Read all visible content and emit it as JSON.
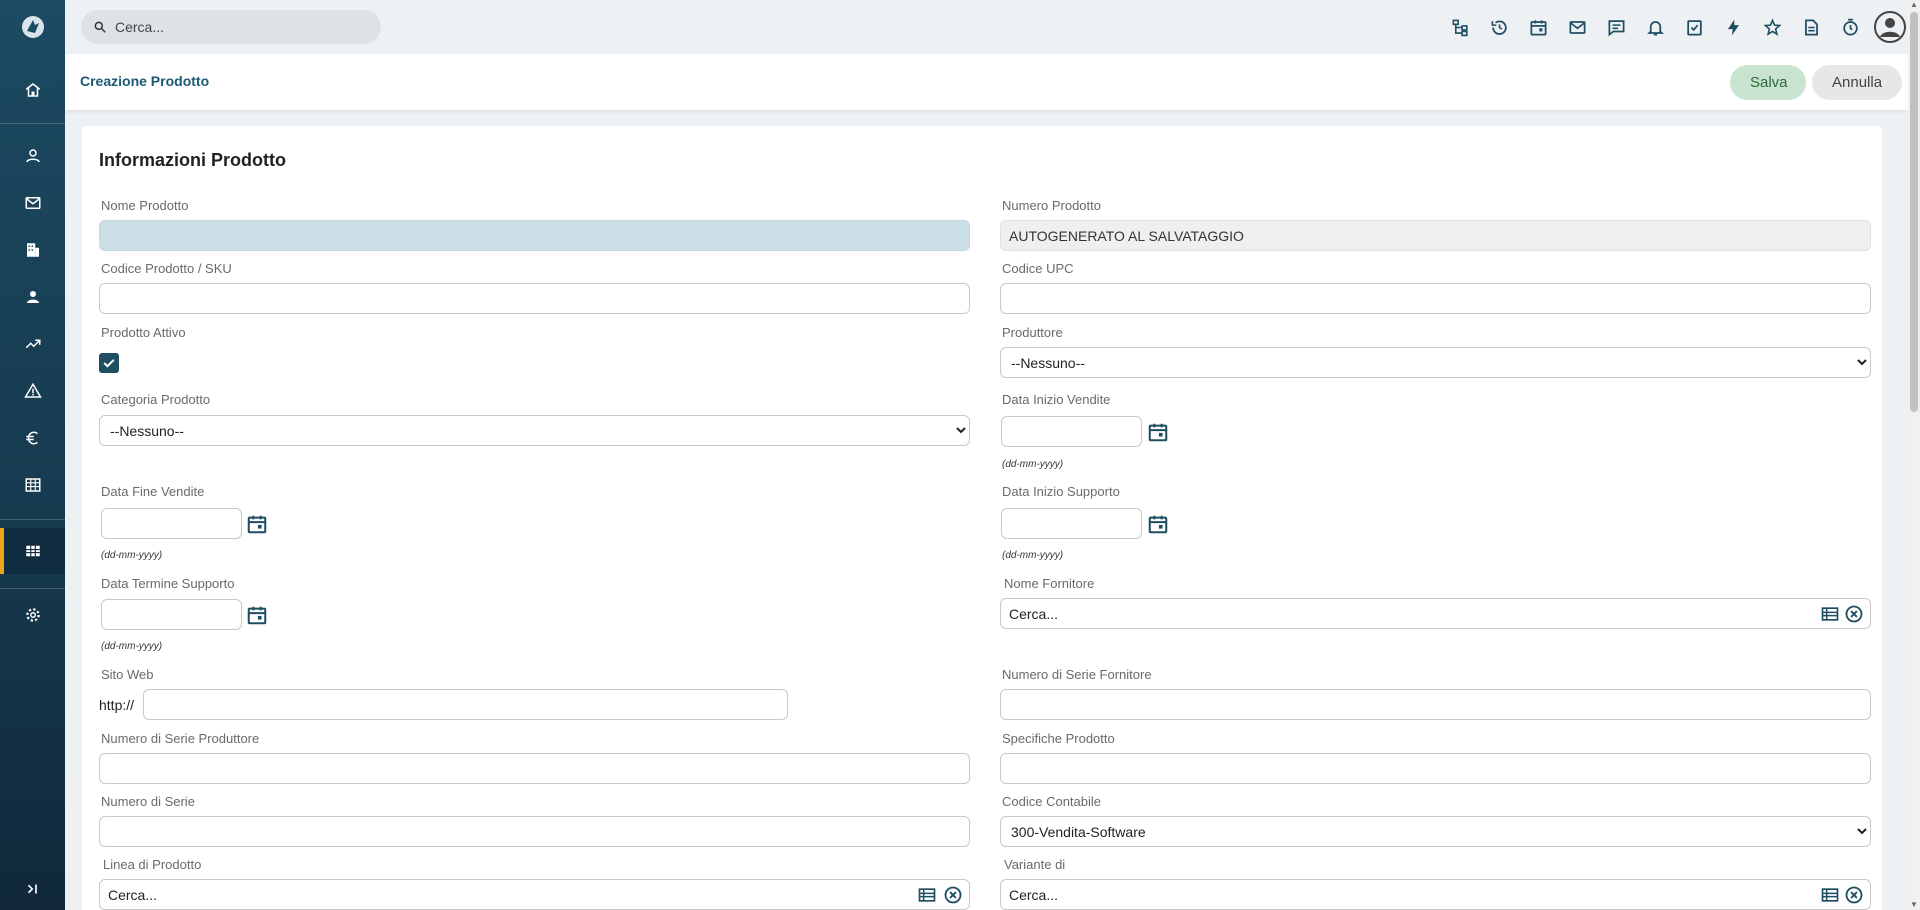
{
  "search": {
    "placeholder": "Cerca..."
  },
  "sidebar": {
    "items": [
      {
        "icon": "home-icon"
      },
      {
        "icon": "user-icon"
      },
      {
        "icon": "mail-icon"
      },
      {
        "icon": "building-icon"
      },
      {
        "icon": "contact-icon"
      },
      {
        "icon": "trend-icon"
      },
      {
        "icon": "warning-icon"
      },
      {
        "icon": "euro-icon"
      },
      {
        "icon": "table-icon"
      },
      {
        "icon": "grid-icon",
        "active": true
      },
      {
        "icon": "gear-icon"
      },
      {
        "icon": "collapse-icon"
      }
    ]
  },
  "topbar": {
    "icons": [
      "hierarchy-icon",
      "history-icon",
      "calendar-icon",
      "mail-icon",
      "chat-icon",
      "bell-icon",
      "task-icon",
      "bolt-icon",
      "star-icon",
      "document-icon",
      "timer-icon"
    ]
  },
  "header": {
    "title": "Creazione Prodotto",
    "save_label": "Salva",
    "cancel_label": "Annulla"
  },
  "form": {
    "section_title": "Informazioni Prodotto",
    "nome_prodotto": {
      "label": "Nome Prodotto",
      "value": ""
    },
    "numero_prodotto": {
      "label": "Numero Prodotto",
      "value": "AUTOGENERATO AL SALVATAGGIO"
    },
    "codice_prodotto": {
      "label": "Codice Prodotto / SKU",
      "value": ""
    },
    "codice_upc": {
      "label": "Codice UPC",
      "value": ""
    },
    "prodotto_attivo": {
      "label": "Prodotto Attivo",
      "checked": true
    },
    "produttore": {
      "label": "Produttore",
      "selected": "--Nessuno--"
    },
    "categoria": {
      "label": "Categoria Prodotto",
      "selected": "--Nessuno--"
    },
    "data_inizio_vendite": {
      "label": "Data Inizio Vendite",
      "hint": "(dd-mm-yyyy)"
    },
    "data_fine_vendite": {
      "label": "Data Fine Vendite",
      "hint": "(dd-mm-yyyy)"
    },
    "data_inizio_supporto": {
      "label": "Data Inizio Supporto",
      "hint": "(dd-mm-yyyy)"
    },
    "data_termine_supporto": {
      "label": "Data Termine Supporto",
      "hint": "(dd-mm-yyyy)"
    },
    "nome_fornitore": {
      "label": "Nome Fornitore",
      "placeholder": "Cerca..."
    },
    "sito_web": {
      "label": "Sito Web",
      "prefix": "http://"
    },
    "serie_fornitore": {
      "label": "Numero di Serie Fornitore"
    },
    "serie_produttore": {
      "label": "Numero di Serie Produttore"
    },
    "specifiche": {
      "label": "Specifiche Prodotto"
    },
    "numero_serie": {
      "label": "Numero di Serie"
    },
    "codice_contabile": {
      "label": "Codice Contabile",
      "selected": "300-Vendita-Software"
    },
    "linea_prodotto": {
      "label": "Linea di Prodotto",
      "placeholder": "Cerca..."
    },
    "variante_di": {
      "label": "Variante di",
      "placeholder": "Cerca..."
    }
  },
  "colors": {
    "sidebar": "#1c4a62",
    "accent": "#f0a21b",
    "title": "#1b5a74",
    "save_bg": "#c8e3cf"
  }
}
